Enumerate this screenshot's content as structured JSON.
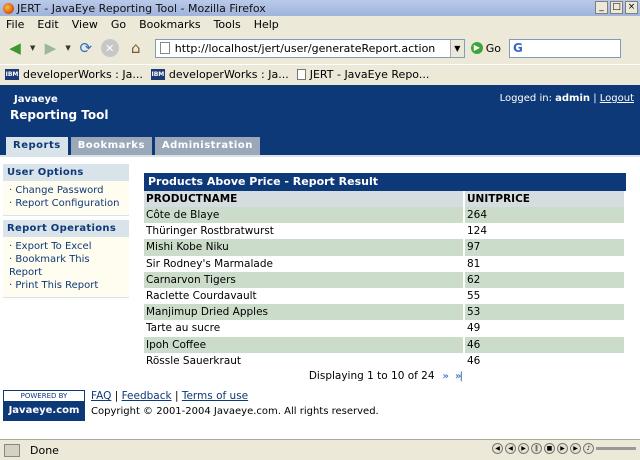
{
  "window": {
    "title": "JERT - JavaEye Reporting Tool - Mozilla Firefox"
  },
  "menu": [
    "File",
    "Edit",
    "View",
    "Go",
    "Bookmarks",
    "Tools",
    "Help"
  ],
  "nav": {
    "url": "http://localhost/jert/user/generateReport.action",
    "go_label": "Go",
    "search_icon_label": "G"
  },
  "bookmarks": [
    {
      "icon": "IBM",
      "label": "developerWorks : Ja..."
    },
    {
      "icon": "IBM",
      "label": "developerWorks : Ja..."
    },
    {
      "icon": "",
      "label": "JERT - JavaEye Repo..."
    }
  ],
  "header": {
    "brand_top": "Javaeye",
    "brand_main": "Reporting Tool",
    "logged_in_label": "Logged in:",
    "user": "admin",
    "separator": "|",
    "logout": "Logout"
  },
  "tabs": [
    {
      "label": "Reports",
      "active": true
    },
    {
      "label": "Bookmarks",
      "active": false
    },
    {
      "label": "Administration",
      "active": false
    }
  ],
  "sidebar": {
    "user_options_title": "User Options",
    "user_options": [
      "· Change Password",
      "· Report Configuration"
    ],
    "report_ops_title": "Report Operations",
    "report_ops": [
      "· Export To Excel",
      "· Bookmark This Report",
      "· Print This Report"
    ]
  },
  "report": {
    "title": "Products Above Price - Report Result",
    "columns": [
      "PRODUCTNAME",
      "UNITPRICE"
    ],
    "rows": [
      [
        "Côte de Blaye",
        "264"
      ],
      [
        "Thüringer Rostbratwurst",
        "124"
      ],
      [
        "Mishi Kobe Niku",
        "97"
      ],
      [
        "Sir Rodney's Marmalade",
        "81"
      ],
      [
        "Carnarvon Tigers",
        "62"
      ],
      [
        "Raclette Courdavault",
        "55"
      ],
      [
        "Manjimup Dried Apples",
        "53"
      ],
      [
        "Tarte au sucre",
        "49"
      ],
      [
        "Ipoh Coffee",
        "46"
      ],
      [
        "Rössle Sauerkraut",
        "46"
      ]
    ],
    "pager_text": "Displaying 1 to 10 of 24",
    "next_icon": "»",
    "last_icon": "»|"
  },
  "footer": {
    "powered_by": "POWERED BY",
    "powered_brand": "Javaeye.com",
    "faq": "FAQ",
    "feedback": "Feedback",
    "terms": "Terms of use",
    "sep": "|",
    "copyright": "Copyright © 2001-2004 Javaeye.com. All rights reserved."
  },
  "status": {
    "text": "Done"
  }
}
